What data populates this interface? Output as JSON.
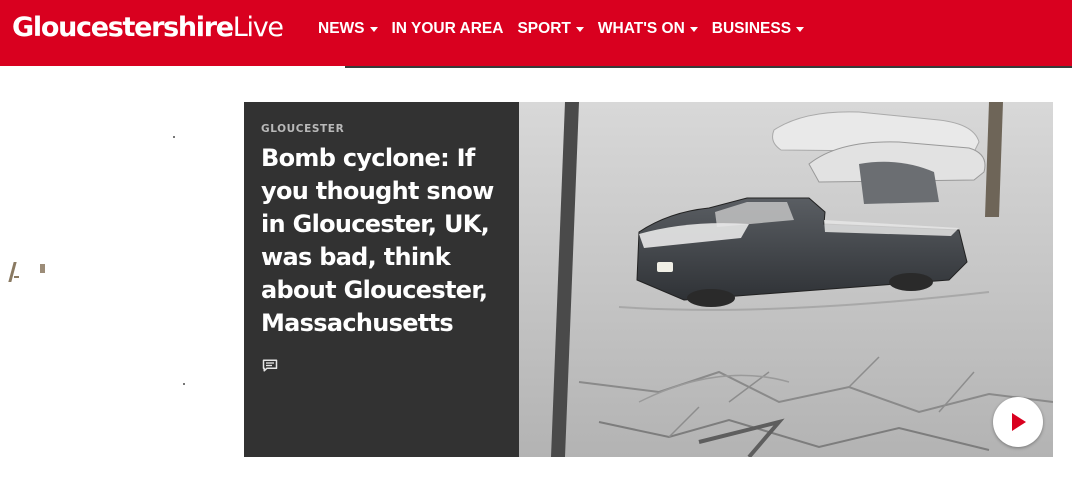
{
  "brand": {
    "name_bold": "Gloucestershire",
    "name_light": "Live",
    "color": "#d9001f"
  },
  "nav": {
    "items": [
      {
        "label": "NEWS",
        "has_dropdown": true
      },
      {
        "label": "IN YOUR AREA",
        "has_dropdown": false
      },
      {
        "label": "SPORT",
        "has_dropdown": true
      },
      {
        "label": "WHAT'S ON",
        "has_dropdown": true
      },
      {
        "label": "BUSINESS",
        "has_dropdown": true
      }
    ]
  },
  "teaser": {
    "kicker": "GLOUCESTER",
    "headline": "Bomb cyclone: If you thought snow in Gloucester, UK, was bad, think about Gloucester, Massachusetts",
    "comment_icon": "comment-icon",
    "media_icon": "play-icon"
  }
}
